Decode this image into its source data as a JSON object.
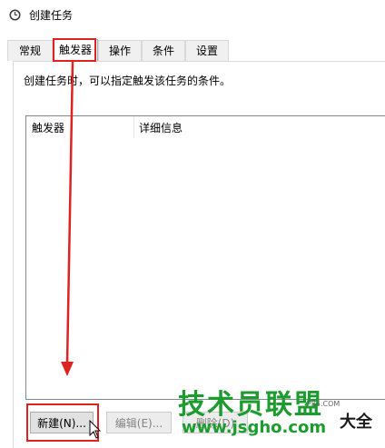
{
  "window": {
    "title": "创建任务"
  },
  "tabs": [
    {
      "label": "常规"
    },
    {
      "label": "触发器",
      "active": true
    },
    {
      "label": "操作"
    },
    {
      "label": "条件"
    },
    {
      "label": "设置"
    }
  ],
  "panel": {
    "description": "创建任务时，可以指定触发该任务的条件。"
  },
  "trigger_list": {
    "columns": [
      "触发器",
      "详细信息"
    ],
    "rows": []
  },
  "buttons": {
    "new": "新建(N)...",
    "edit": "编辑(E)...",
    "delete": "删除(D)"
  },
  "watermark": {
    "brand": "技术员联盟",
    "url": "www.jsgho.com",
    "side": "大全",
    "small": "P85.COM"
  },
  "colors": {
    "highlight": "#dd2222",
    "watermark_green": "#1c9c2e"
  }
}
